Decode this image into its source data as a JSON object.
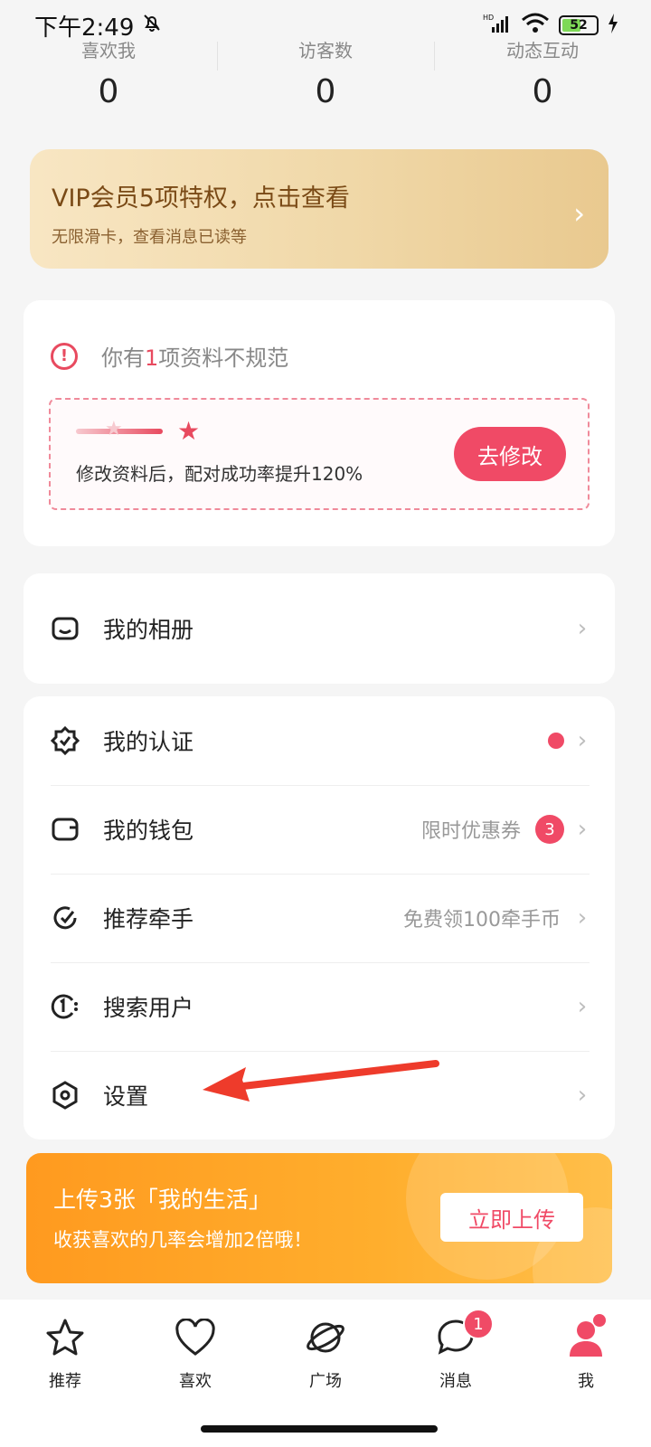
{
  "status_bar": {
    "time": "下午2:49",
    "battery": "52"
  },
  "stats": [
    {
      "label": "喜欢我",
      "value": "0"
    },
    {
      "label": "访客数",
      "value": "0"
    },
    {
      "label": "动态互动",
      "value": "0"
    }
  ],
  "vip": {
    "title": "VIP会员5项特权，点击查看",
    "subtitle": "无限滑卡，查看消息已读等"
  },
  "profile_warning": {
    "prefix": "你有",
    "count": "1",
    "suffix": "项资料不规范",
    "tip": "修改资料后，配对成功率提升120%",
    "button": "去修改"
  },
  "album": {
    "label": "我的相册"
  },
  "menu": [
    {
      "label": "我的认证",
      "hint": "",
      "dot": true
    },
    {
      "label": "我的钱包",
      "hint": "限时优惠券",
      "badge": "3"
    },
    {
      "label": "推荐牵手",
      "hint": "免费领100牵手币"
    },
    {
      "label": "搜索用户",
      "hint": ""
    },
    {
      "label": "设置",
      "hint": ""
    }
  ],
  "upload_banner": {
    "title": "上传3张「我的生活」",
    "subtitle": "收获喜欢的几率会增加2倍哦！",
    "button": "立即上传"
  },
  "tabs": [
    {
      "label": "推荐",
      "icon": "star-icon"
    },
    {
      "label": "喜欢",
      "icon": "heart-icon"
    },
    {
      "label": "广场",
      "icon": "planet-icon"
    },
    {
      "label": "消息",
      "icon": "chat-icon",
      "badge": "1"
    },
    {
      "label": "我",
      "icon": "person-icon",
      "active": true
    }
  ],
  "colors": {
    "accent": "#f04a66",
    "vip_text": "#7a4a16",
    "banner": "#ffa726"
  }
}
